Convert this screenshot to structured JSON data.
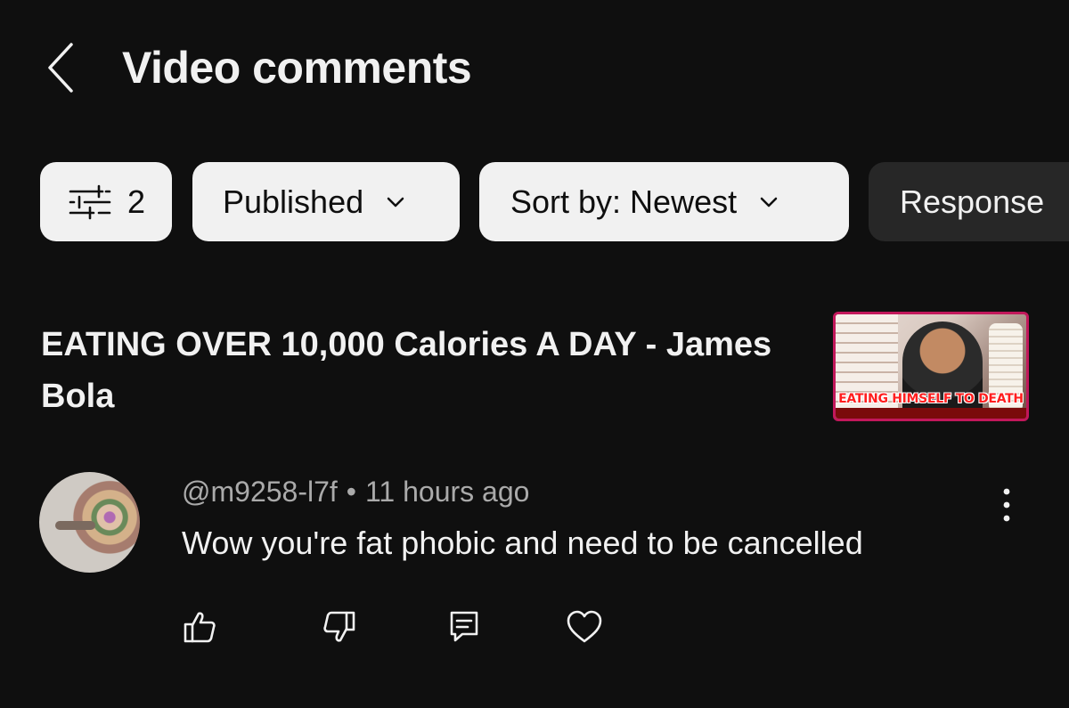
{
  "header": {
    "title": "Video comments",
    "back_icon": "chevron-left-icon"
  },
  "filters": {
    "filter_count": "2",
    "published_label": "Published",
    "sort_label": "Sort by: Newest",
    "response_label": "Response"
  },
  "video": {
    "title": "EATING OVER 10,000 Calories A DAY - James Bola",
    "thumbnail_caption": "EATING HIMSELF TO DEATH"
  },
  "comment": {
    "author": "@m9258-l7f",
    "separator": "•",
    "time": "11 hours ago",
    "text": "Wow you're fat phobic and need to be cancelled",
    "actions": [
      "like-icon",
      "dislike-icon",
      "reply-icon",
      "heart-icon"
    ]
  },
  "colors": {
    "background": "#0f0f0f",
    "chip_light": "#f1f1f1",
    "chip_dark": "#272727",
    "text_primary": "#f1f1f1",
    "text_secondary": "#aaaaaa"
  }
}
